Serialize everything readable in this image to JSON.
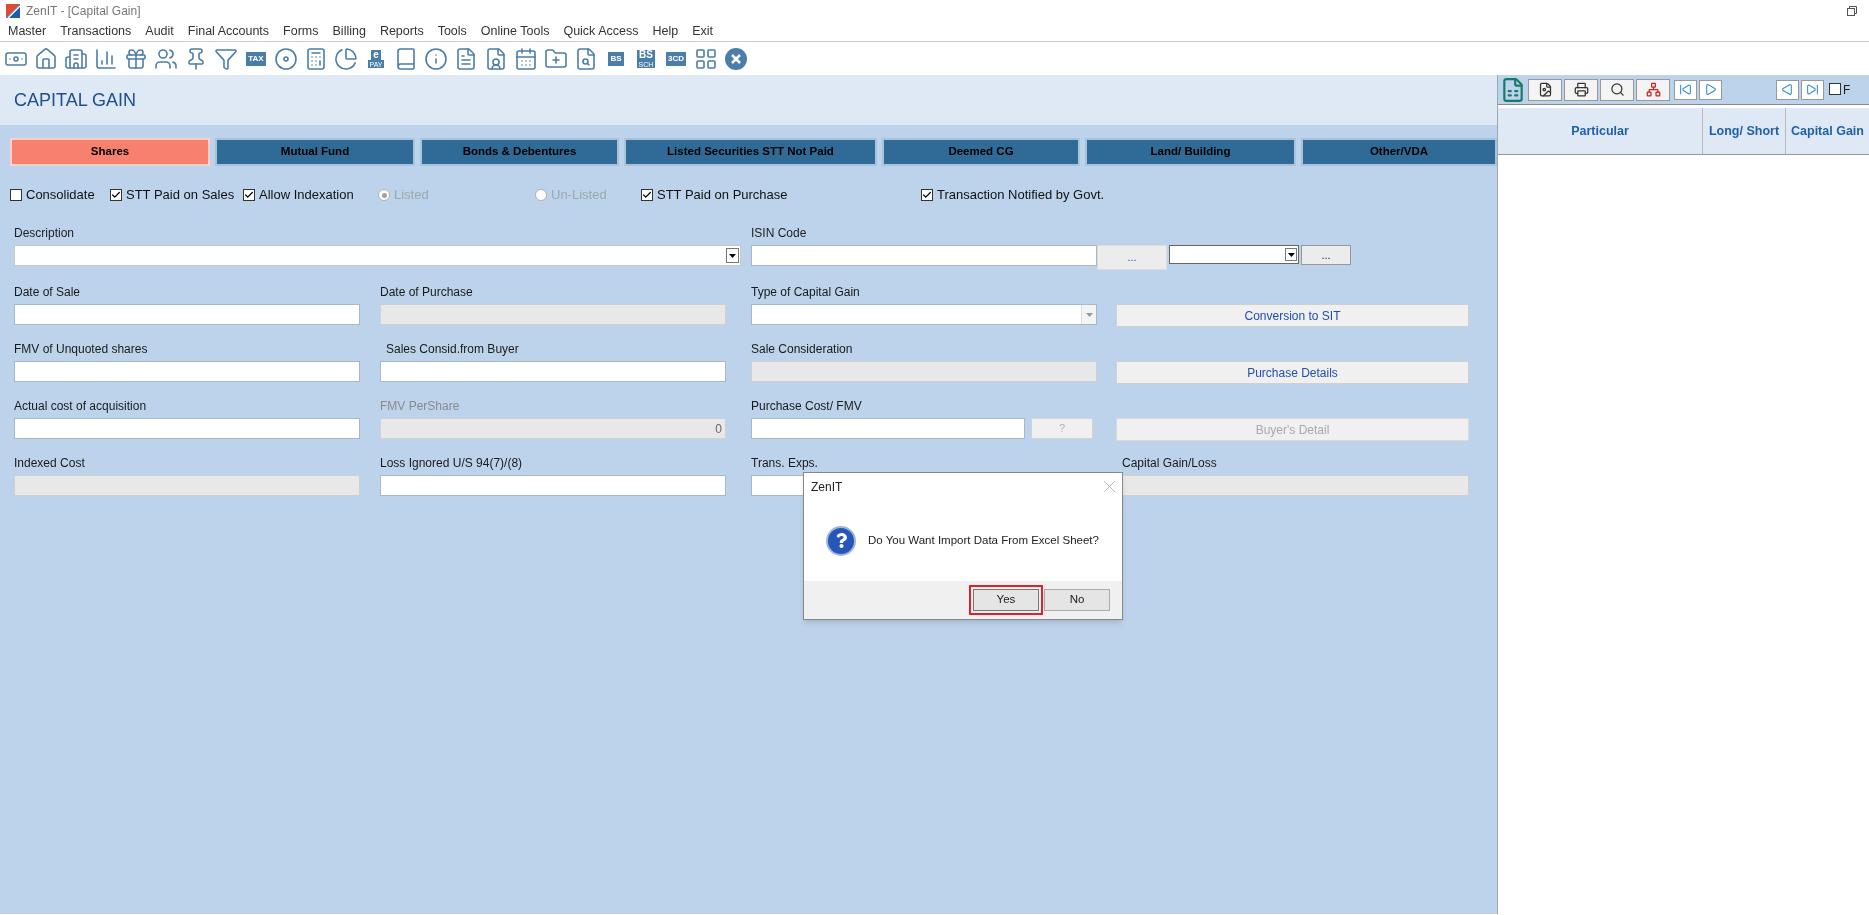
{
  "window": {
    "title": "ZenIT - [Capital Gain]"
  },
  "menu": [
    "Master",
    "Transactions",
    "Audit",
    "Final Accounts",
    "Forms",
    "Billing",
    "Reports",
    "Tools",
    "Online Tools",
    "Quick Access",
    "Help",
    "Exit"
  ],
  "toolbar_badges": [
    {
      "text": "TAX"
    },
    {
      "text": "e",
      "sub": "PAY"
    },
    {
      "text": "BS"
    },
    {
      "text": "BS",
      "sub": "SCH"
    },
    {
      "text": "3CD"
    }
  ],
  "page_title": "CAPITAL GAIN",
  "tabs": [
    {
      "label": "Shares",
      "selected": true
    },
    {
      "label": "Mutual Fund",
      "selected": false
    },
    {
      "label": "Bonds & Debentures",
      "selected": false
    },
    {
      "label": "Listed Securities STT Not Paid",
      "selected": false
    },
    {
      "label": "Deemed CG",
      "selected": false
    },
    {
      "label": "Land/ Building",
      "selected": false
    },
    {
      "label": "Other/VDA",
      "selected": false
    }
  ],
  "options": [
    {
      "kind": "checkbox",
      "label": "Consolidate",
      "checked": false,
      "disabled": false
    },
    {
      "kind": "checkbox",
      "label": "STT Paid on Sales",
      "checked": true,
      "disabled": false
    },
    {
      "kind": "checkbox",
      "label": "Allow Indexation",
      "checked": true,
      "disabled": false
    },
    {
      "kind": "radio",
      "label": "Listed",
      "selected": true,
      "disabled": true
    },
    {
      "kind": "radio",
      "label": "Un-Listed",
      "selected": false,
      "disabled": true
    },
    {
      "kind": "checkbox",
      "label": "STT Paid on Purchase",
      "checked": true,
      "disabled": false
    },
    {
      "kind": "checkbox",
      "label": "Transaction Notified by Govt.",
      "checked": true,
      "disabled": false
    }
  ],
  "description": {
    "label": "Description"
  },
  "isin": {
    "label": "ISIN Code",
    "button": "...",
    "button_2": "..."
  },
  "rows": [
    [
      {
        "kind": "text",
        "label": "Date of Sale",
        "disabled": false
      },
      {
        "kind": "text",
        "label": "Date of Purchase",
        "disabled": true
      },
      {
        "kind": "combo",
        "label": "Type of Capital Gain",
        "disabled": false
      },
      {
        "kind": "button",
        "label": "Conversion to SIT",
        "disabled": false
      }
    ],
    [
      {
        "kind": "text",
        "label": "FMV of Unquoted shares",
        "disabled": false
      },
      {
        "kind": "text",
        "label": "Sales Consid.from Buyer",
        "disabled": false
      },
      {
        "kind": "text",
        "label": "Sale Consideration",
        "disabled": true
      },
      {
        "kind": "button",
        "label": "Purchase Details",
        "disabled": false
      }
    ],
    [
      {
        "kind": "text",
        "label": "Actual cost of acquisition",
        "disabled": false
      },
      {
        "kind": "text",
        "label": "FMV PerShare",
        "disabled": true,
        "dimmed": true,
        "value": "0"
      },
      {
        "kind": "text-button",
        "label": "Purchase Cost/ FMV",
        "disabled": false,
        "button": "?",
        "button_disabled": true
      },
      {
        "kind": "button",
        "label": "Buyer's Detail",
        "disabled": true
      }
    ],
    [
      {
        "kind": "text",
        "label": "Indexed Cost",
        "disabled": true
      },
      {
        "kind": "text",
        "label": "Loss Ignored U/S 94(7)/(8)",
        "disabled": false
      },
      {
        "kind": "text",
        "label": "Trans. Exps.",
        "disabled": false
      },
      {
        "kind": "text",
        "label": "Capital Gain/Loss",
        "disabled": true
      }
    ]
  ],
  "side_panel": {
    "checkbox": {
      "label": "F",
      "checked": false
    },
    "columns": [
      "Particular",
      "Long/ Short",
      "Capital Gain"
    ]
  },
  "dialog": {
    "title": "ZenIT",
    "message": "Do You Want Import Data From Excel Sheet?",
    "buttons": [
      {
        "label": "Yes",
        "selected": true
      },
      {
        "label": "No",
        "selected": false
      }
    ]
  }
}
